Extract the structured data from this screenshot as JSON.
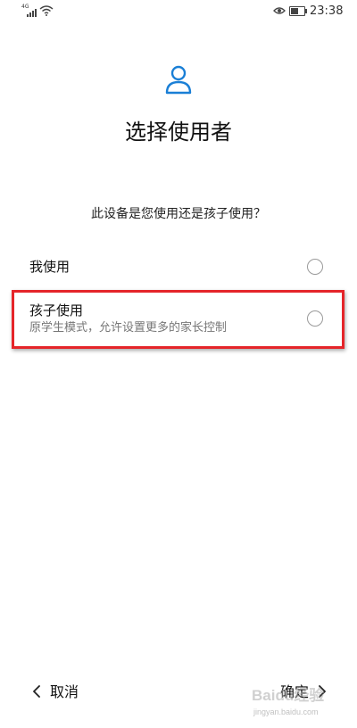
{
  "status_bar": {
    "signal_label": "4G",
    "time": "23:38",
    "icons": [
      "signal-icon",
      "wifi-icon",
      "eye-icon",
      "battery-icon"
    ]
  },
  "header": {
    "icon": "user-icon",
    "title": "选择使用者"
  },
  "question": "此设备是您使用还是孩子使用？",
  "options": [
    {
      "label": "我使用",
      "sublabel": "",
      "selected": false
    },
    {
      "label": "孩子使用",
      "sublabel": "原学生模式，允许设置更多的家长控制",
      "selected": false,
      "highlighted": true
    }
  ],
  "bottom_bar": {
    "cancel_label": "取消",
    "confirm_label": "确定"
  },
  "watermark": {
    "main": "Baidu经验",
    "sub": "jingyan.baidu.com"
  },
  "colors": {
    "accent": "#1a7fd6",
    "highlight_border": "#e5252a",
    "radio_border": "#9a9a9a",
    "secondary_text": "#777777"
  }
}
